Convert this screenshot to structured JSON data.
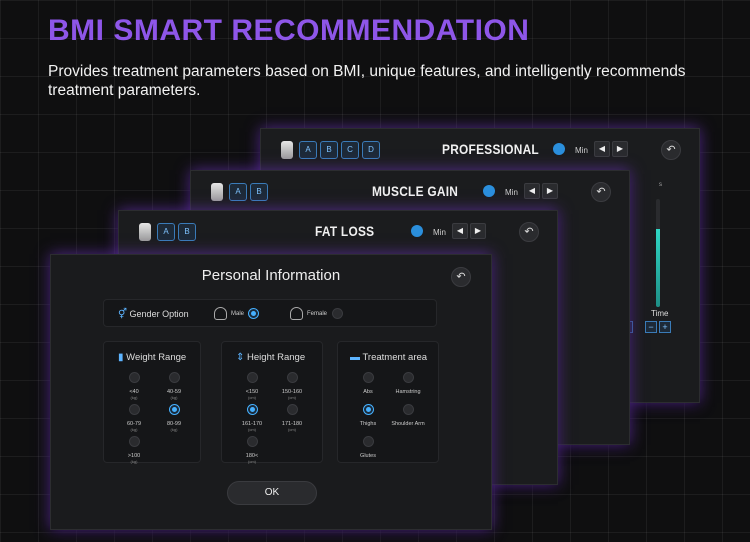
{
  "headline": "BMI SMART RECOMMENDATION",
  "subtitle": "Provides treatment parameters based on BMI, unique features, and intelligently recommends treatment parameters.",
  "panels": {
    "professional": {
      "title": "PROFESSIONAL",
      "tabs": [
        "A",
        "B",
        "C",
        "D"
      ],
      "min_label": "Min",
      "slider_top": "s",
      "time_label": "Time",
      "minus": "−",
      "plus": "+",
      "slider_level": 0.72
    },
    "muscle": {
      "title": "MUSCLE GAIN",
      "tabs": [
        "A",
        "B"
      ],
      "min_label": "Min"
    },
    "fatloss": {
      "title": "FAT LOSS",
      "tabs": [
        "A",
        "B"
      ],
      "min_label": "Min"
    }
  },
  "icons": {
    "prev": "◀",
    "next": "▶",
    "back": "↶",
    "gender": "⚥",
    "weight": "▮",
    "height": "⇕",
    "treat": "▬"
  },
  "main": {
    "title": "Personal Information",
    "gender": {
      "label": "Gender Option",
      "male": "Male",
      "female": "Female",
      "selected": "Male"
    },
    "weight": {
      "title": "Weight Range",
      "options": [
        {
          "label": "<40",
          "unit": "(kg)"
        },
        {
          "label": "40-59",
          "unit": "(kg)"
        },
        {
          "label": "60-79",
          "unit": "(kg)"
        },
        {
          "label": "80-99",
          "unit": "(kg)"
        },
        {
          "label": ">100",
          "unit": "(kg)"
        }
      ],
      "selected": "80-99"
    },
    "height": {
      "title": "Height Range",
      "options": [
        {
          "label": "<150",
          "unit": "(cm)"
        },
        {
          "label": "150-160",
          "unit": "(cm)"
        },
        {
          "label": "161-170",
          "unit": "(cm)"
        },
        {
          "label": "171-180",
          "unit": "(cm)"
        },
        {
          "label": "180<",
          "unit": "(cm)"
        }
      ],
      "selected": "161-170"
    },
    "treatment": {
      "title": "Treatment area",
      "options": [
        {
          "label": "Abs"
        },
        {
          "label": "Hamstring"
        },
        {
          "label": "Thighs"
        },
        {
          "label": "Shoulder Arm"
        },
        {
          "label": "Glutes"
        }
      ],
      "selected": "Thighs"
    },
    "ok": "OK"
  }
}
